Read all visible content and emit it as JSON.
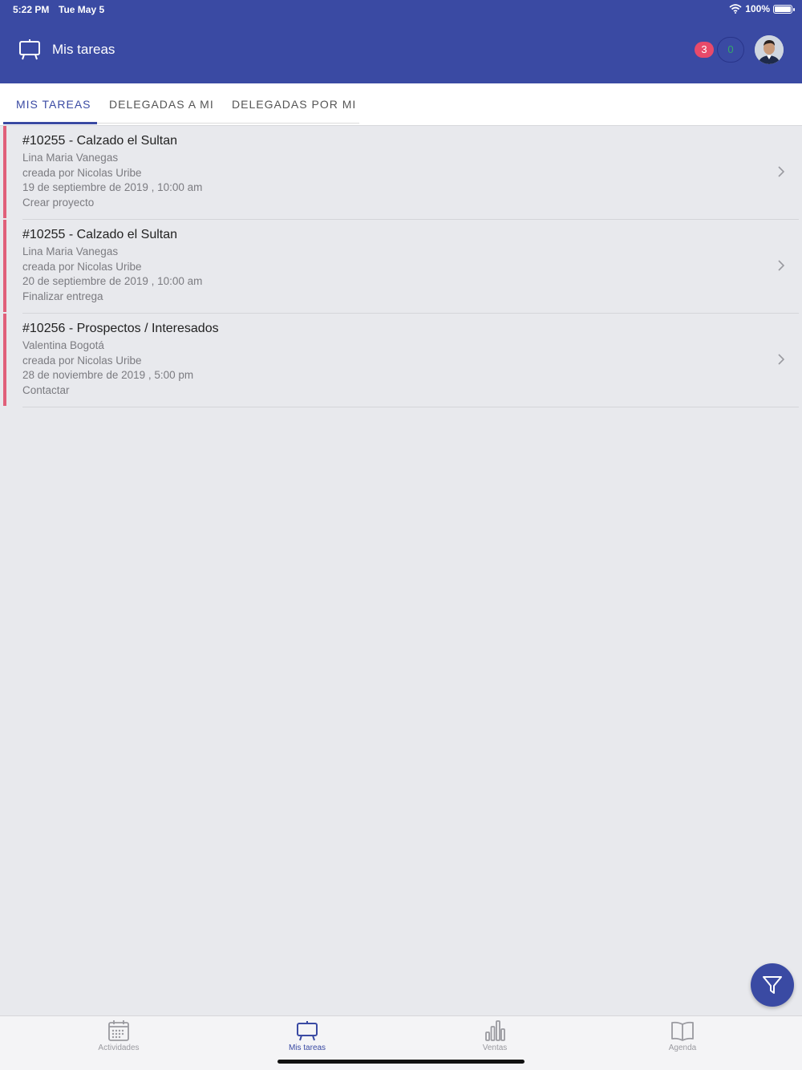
{
  "status": {
    "time": "5:22 PM",
    "date": "Tue May 5",
    "battery": "100%"
  },
  "header": {
    "title": "Mis tareas",
    "badge_red": "3",
    "badge_green": "0"
  },
  "tabs": [
    {
      "label": "MIS TAREAS",
      "active": true
    },
    {
      "label": "DELEGADAS A MI",
      "active": false
    },
    {
      "label": "DELEGADAS POR MI",
      "active": false
    }
  ],
  "tasks": [
    {
      "title": "#10255 - Calzado el Sultan",
      "contact": "Lina Maria Vanegas",
      "created_by": "creada por Nicolas Uribe",
      "datetime": "19 de septiembre de 2019 , 10:00 am",
      "action": "Crear proyecto"
    },
    {
      "title": "#10255 - Calzado el Sultan",
      "contact": "Lina Maria Vanegas",
      "created_by": "creada por Nicolas Uribe",
      "datetime": "20 de septiembre de 2019 , 10:00 am",
      "action": "Finalizar entrega"
    },
    {
      "title": "#10256 - Prospectos / Interesados",
      "contact": "Valentina Bogotá",
      "created_by": "creada por Nicolas Uribe",
      "datetime": "28 de noviembre de 2019 , 5:00 pm",
      "action": "Contactar"
    }
  ],
  "bottom_nav": [
    {
      "label": "Actividades",
      "icon": "calendar-icon",
      "active": false
    },
    {
      "label": "Mis tareas",
      "icon": "board-icon",
      "active": true
    },
    {
      "label": "Ventas",
      "icon": "bar-chart-icon",
      "active": false
    },
    {
      "label": "Agenda",
      "icon": "book-icon",
      "active": false
    }
  ],
  "colors": {
    "primary": "#3a4aa3",
    "accent_red": "#e0607a",
    "badge_red": "#e84a6a",
    "badge_green_text": "#34a86a",
    "background": "#e8e9ed"
  }
}
